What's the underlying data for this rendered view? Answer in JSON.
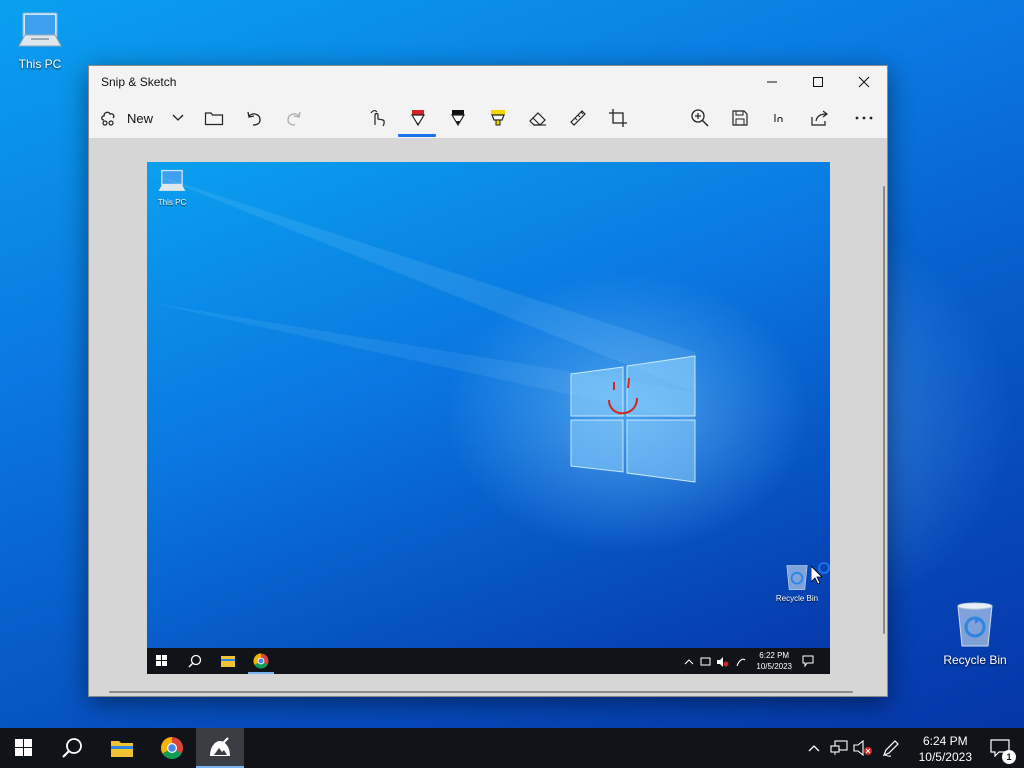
{
  "desktop": {
    "icons": [
      {
        "label": "This PC",
        "icon": "this-pc-icon"
      },
      {
        "label": "Recycle Bin",
        "icon": "recycle-bin-icon"
      }
    ]
  },
  "window": {
    "title": "Snip & Sketch",
    "controls": [
      "minimize",
      "maximize",
      "close"
    ],
    "toolbar": {
      "new_label": "New",
      "tools": [
        "touch-writing",
        "ballpoint-pen",
        "pencil",
        "highlighter",
        "eraser",
        "ruler",
        "image-crop",
        "zoom",
        "save",
        "copy",
        "share",
        "see-more"
      ],
      "active_tool": "ballpoint-pen",
      "pen_color": "#d42424",
      "highlighter_color": "#f2d600"
    },
    "snip": {
      "icons": [
        {
          "label": "This PC"
        },
        {
          "label": "Recycle Bin"
        }
      ],
      "tray_time": "6:22 PM",
      "tray_date": "10/5/2023"
    }
  },
  "taskbar": {
    "items": [
      "start",
      "search",
      "file-explorer",
      "chrome",
      "snip-and-sketch"
    ],
    "active_item": "snip-and-sketch",
    "time": "6:24 PM",
    "date": "10/5/2023",
    "notification_count": "1"
  },
  "colors": {
    "accent": "#1a73e8",
    "taskbar": "#101318"
  }
}
